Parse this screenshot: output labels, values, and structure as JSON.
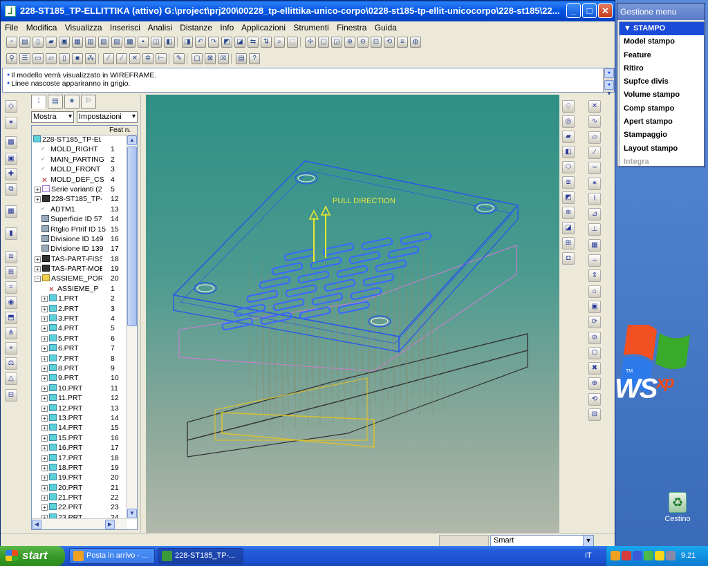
{
  "window": {
    "title": "228-ST185_TP-ELLITTIKA (attivo) G:\\project\\prj200\\00228_tp-ellittika-unico-corpo\\0228-st185-tp-ellit-unicocorpo\\228-st185\\22...",
    "minimize": "_",
    "maximize": "□",
    "close": "✕"
  },
  "menu": [
    "File",
    "Modifica",
    "Visualizza",
    "Inserisci",
    "Analisi",
    "Distanze",
    "Info",
    "Applicazioni",
    "Strumenti",
    "Finestra",
    "Guida"
  ],
  "messages": [
    "Il modello verrà visualizzato in WIREFRAME.",
    "Linee nascoste appariranno in grigio."
  ],
  "tree": {
    "show_label": "Mostra",
    "settings_label": "Impostazioni",
    "feat_header": "Feat n.",
    "root": "228-ST185_TP-ELL",
    "rows": [
      {
        "label": "MOLD_RIGHT",
        "num": "1",
        "indent": 1,
        "kind": "plane"
      },
      {
        "label": "MAIN_PARTING",
        "num": "2",
        "indent": 1,
        "kind": "plane"
      },
      {
        "label": "MOLD_FRONT",
        "num": "3",
        "indent": 1,
        "kind": "plane"
      },
      {
        "label": "MOLD_DEF_CS",
        "num": "4",
        "indent": 1,
        "kind": "csys"
      },
      {
        "label": "Serie varianti (22",
        "num": "5",
        "indent": 0,
        "kind": "folder",
        "expand": true
      },
      {
        "label": "228-ST185_TP-",
        "num": "12",
        "indent": 0,
        "kind": "part",
        "expand": true
      },
      {
        "label": "ADTM1",
        "num": "13",
        "indent": 1,
        "kind": "plane"
      },
      {
        "label": "Superficie ID 57",
        "num": "14",
        "indent": 1,
        "kind": "surf"
      },
      {
        "label": "Rtglio Prtrif ID 15",
        "num": "15",
        "indent": 1,
        "kind": "surf"
      },
      {
        "label": "Divisione ID 149",
        "num": "16",
        "indent": 1,
        "kind": "div"
      },
      {
        "label": "Divisione ID 139",
        "num": "17",
        "indent": 1,
        "kind": "div"
      },
      {
        "label": "TAS-PART-FISS",
        "num": "18",
        "indent": 0,
        "kind": "part",
        "expand": true
      },
      {
        "label": "TAS-PART-MOB",
        "num": "19",
        "indent": 0,
        "kind": "part",
        "expand": true
      },
      {
        "label": "ASSIEME_POR",
        "num": "20",
        "indent": 0,
        "kind": "asm",
        "expand": true,
        "open": true
      },
      {
        "label": "ASSIEME_P",
        "num": "1",
        "indent": 2,
        "kind": "csys"
      },
      {
        "label": "1.PRT",
        "num": "2",
        "indent": 1,
        "kind": "prt",
        "expand": true
      },
      {
        "label": "2.PRT",
        "num": "3",
        "indent": 1,
        "kind": "prt",
        "expand": true
      },
      {
        "label": "3.PRT",
        "num": "4",
        "indent": 1,
        "kind": "prt",
        "expand": true
      },
      {
        "label": "4.PRT",
        "num": "5",
        "indent": 1,
        "kind": "prt",
        "expand": true
      },
      {
        "label": "5.PRT",
        "num": "6",
        "indent": 1,
        "kind": "prt",
        "expand": true
      },
      {
        "label": "6.PRT",
        "num": "7",
        "indent": 1,
        "kind": "prt",
        "expand": true
      },
      {
        "label": "7.PRT",
        "num": "8",
        "indent": 1,
        "kind": "prt",
        "expand": true
      },
      {
        "label": "8.PRT",
        "num": "9",
        "indent": 1,
        "kind": "prt",
        "expand": true
      },
      {
        "label": "9.PRT",
        "num": "10",
        "indent": 1,
        "kind": "prt",
        "expand": true
      },
      {
        "label": "10.PRT",
        "num": "11",
        "indent": 1,
        "kind": "prt",
        "expand": true
      },
      {
        "label": "11.PRT",
        "num": "12",
        "indent": 1,
        "kind": "prt",
        "expand": true
      },
      {
        "label": "12.PRT",
        "num": "13",
        "indent": 1,
        "kind": "prt",
        "expand": true
      },
      {
        "label": "13.PRT",
        "num": "14",
        "indent": 1,
        "kind": "prt",
        "expand": true
      },
      {
        "label": "14.PRT",
        "num": "15",
        "indent": 1,
        "kind": "prt",
        "expand": true
      },
      {
        "label": "15.PRT",
        "num": "16",
        "indent": 1,
        "kind": "prt",
        "expand": true
      },
      {
        "label": "16.PRT",
        "num": "17",
        "indent": 1,
        "kind": "prt",
        "expand": true
      },
      {
        "label": "17.PRT",
        "num": "18",
        "indent": 1,
        "kind": "prt",
        "expand": true
      },
      {
        "label": "18.PRT",
        "num": "19",
        "indent": 1,
        "kind": "prt",
        "expand": true
      },
      {
        "label": "19.PRT",
        "num": "20",
        "indent": 1,
        "kind": "prt",
        "expand": true
      },
      {
        "label": "20.PRT",
        "num": "21",
        "indent": 1,
        "kind": "prt",
        "expand": true
      },
      {
        "label": "21.PRT",
        "num": "22",
        "indent": 1,
        "kind": "prt",
        "expand": true
      },
      {
        "label": "22.PRT",
        "num": "23",
        "indent": 1,
        "kind": "prt",
        "expand": true
      },
      {
        "label": "23.PRT",
        "num": "24",
        "indent": 1,
        "kind": "prt",
        "expand": true
      }
    ]
  },
  "viewport": {
    "annotation": "PULL DIRECTION",
    "colors": {
      "top_plate": "#2a5ae8",
      "wire": "#8a8a6a",
      "cavity": "#3a6aff",
      "pull": "#e8e830",
      "pink": "#d87ad8",
      "yellow": "#d8c030"
    }
  },
  "status": {
    "filter": "Smart"
  },
  "menu_manager": {
    "title": "Gestione menu",
    "header": "STAMPO",
    "items": [
      {
        "label": "Model stampo",
        "enabled": true
      },
      {
        "label": "Feature",
        "enabled": true
      },
      {
        "label": "Ritiro",
        "enabled": true
      },
      {
        "label": "Supfce divis",
        "enabled": true
      },
      {
        "label": "Volume stampo",
        "enabled": true
      },
      {
        "label": "Comp stampo",
        "enabled": true
      },
      {
        "label": "Apert stampo",
        "enabled": true
      },
      {
        "label": "Stampaggio",
        "enabled": true
      },
      {
        "label": "Layout stampo",
        "enabled": true
      },
      {
        "label": "Integra",
        "enabled": false
      }
    ]
  },
  "taskbar": {
    "start": "start",
    "tasks": [
      {
        "label": "Posta in arrivo - ...",
        "icon_color": "#f0a020"
      },
      {
        "label": "228-ST185_TP-...",
        "icon_color": "#3a9a3a"
      }
    ],
    "language": "IT",
    "clock": "9.21"
  },
  "desktop": {
    "recycle_bin": "Cestino",
    "os_text": "WS",
    "os_sup": "xp",
    "tm": "TM"
  }
}
